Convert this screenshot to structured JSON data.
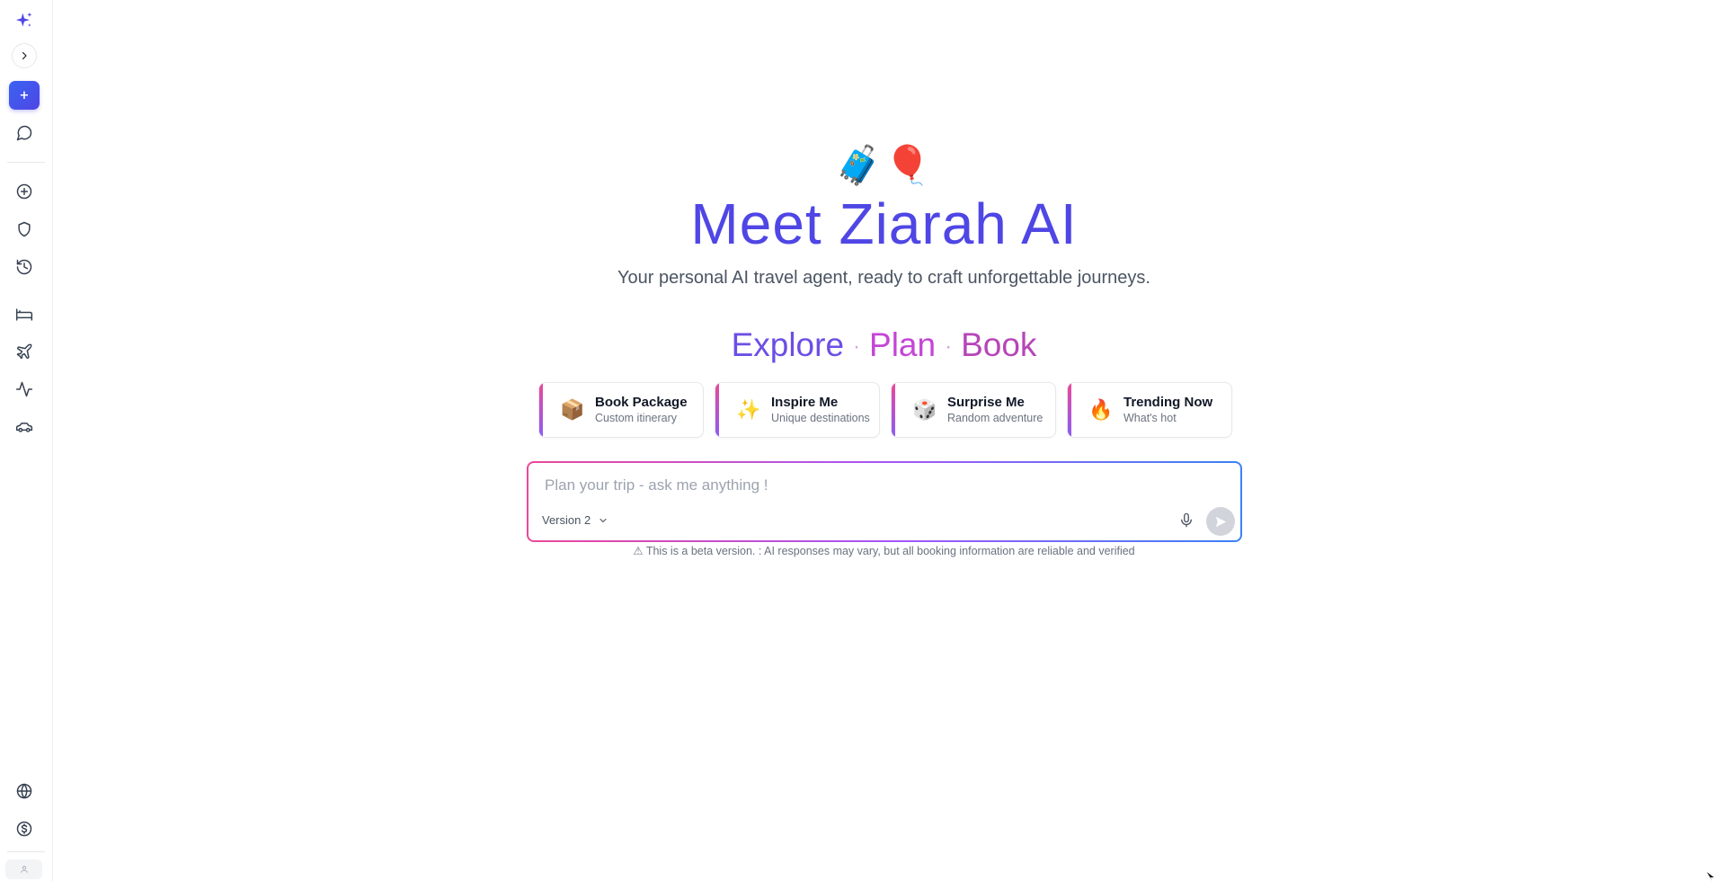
{
  "sidebar": {
    "logo_icon": "sparkles-icon",
    "toggle_icon": "chevron-right-icon",
    "new_chat_label": "+",
    "items": [
      {
        "name": "chat",
        "icon": "message-circle-icon"
      },
      {
        "name": "add",
        "icon": "plus-circle-icon"
      },
      {
        "name": "shield",
        "icon": "shield-icon"
      },
      {
        "name": "history",
        "icon": "history-icon"
      },
      {
        "name": "hotels",
        "icon": "bed-icon"
      },
      {
        "name": "flights",
        "icon": "plane-icon"
      },
      {
        "name": "activity",
        "icon": "activity-icon"
      },
      {
        "name": "cars",
        "icon": "car-icon"
      },
      {
        "name": "language",
        "icon": "globe-icon"
      },
      {
        "name": "currency",
        "icon": "dollar-circle-icon"
      }
    ],
    "avatar_icon": "user-icon"
  },
  "hero": {
    "emojis": "🧳🎈",
    "title": "Meet Ziarah AI",
    "subtitle": "Your personal AI travel agent, ready to craft unforgettable journeys."
  },
  "tagline": {
    "word1": "Explore",
    "separator": "·",
    "word2": "Plan",
    "word3": "Book"
  },
  "cards": [
    {
      "icon": "📦",
      "title": "Book Package",
      "subtitle": "Custom itinerary"
    },
    {
      "icon": "✨",
      "title": "Inspire Me",
      "subtitle": "Unique destinations"
    },
    {
      "icon": "🎲",
      "title": "Surprise Me",
      "subtitle": "Random adventure"
    },
    {
      "icon": "🔥",
      "title": "Trending Now",
      "subtitle": "What's hot"
    }
  ],
  "chat": {
    "placeholder": "Plan your trip - ask me anything !",
    "value": "",
    "version_label": "Version 2",
    "mic_icon": "microphone-icon",
    "send_icon": "send-icon"
  },
  "disclaimer": "⚠ This is a beta version. : AI responses may vary, but all booking information are reliable and verified",
  "colors": {
    "accent": "#4f46e5",
    "gradient_pink": "#ec4899",
    "gradient_purple": "#a855f7",
    "gradient_blue": "#3b82f6"
  }
}
